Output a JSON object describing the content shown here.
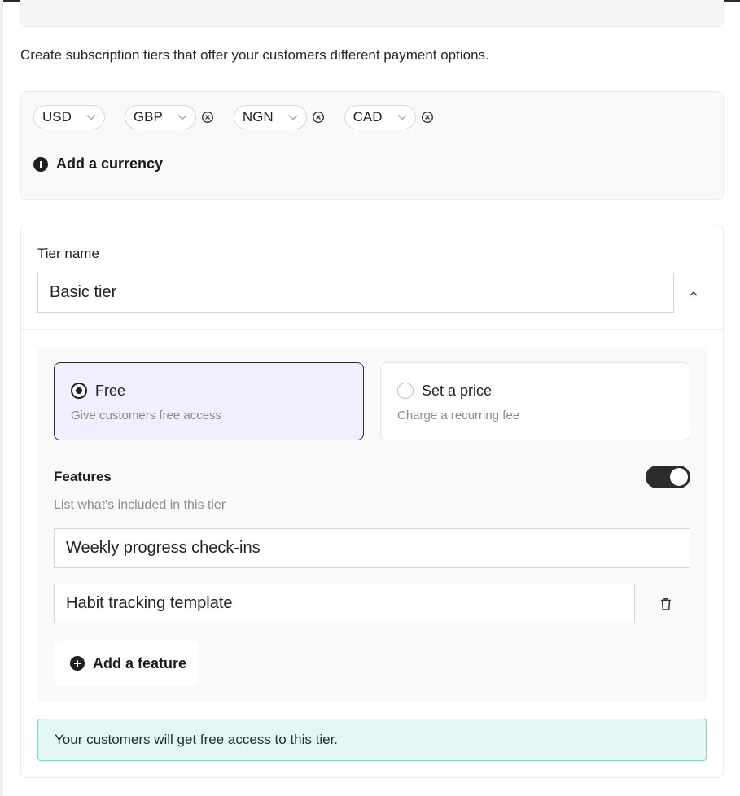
{
  "intro_text": "Create subscription tiers that offer your customers different payment options.",
  "currencies": {
    "items": [
      {
        "code": "USD",
        "removable": false
      },
      {
        "code": "GBP",
        "removable": true
      },
      {
        "code": "NGN",
        "removable": true
      },
      {
        "code": "CAD",
        "removable": true
      }
    ],
    "add_label": "Add a currency"
  },
  "tier": {
    "name_label": "Tier name",
    "name_value": "Basic tier",
    "pricing_options": [
      {
        "title": "Free",
        "description": "Give customers free access",
        "selected": true
      },
      {
        "title": "Set a price",
        "description": "Charge a recurring fee",
        "selected": false
      }
    ],
    "features": {
      "label": "Features",
      "sublabel": "List what's included in this tier",
      "enabled": true,
      "items": [
        "Weekly progress check-ins",
        "Habit tracking template"
      ],
      "add_label": "Add a feature"
    },
    "notice": "Your customers will get free access to this tier."
  },
  "colors": {
    "accent_dark": "#1f1f1f",
    "selected_option_bg": "#f1effd",
    "notice_bg": "#e4f6f4",
    "notice_border": "#7fd3c8"
  },
  "icons": [
    "chevron-down-icon",
    "remove-circle-icon",
    "plus-circle-icon",
    "chevron-up-icon",
    "trash-icon"
  ]
}
